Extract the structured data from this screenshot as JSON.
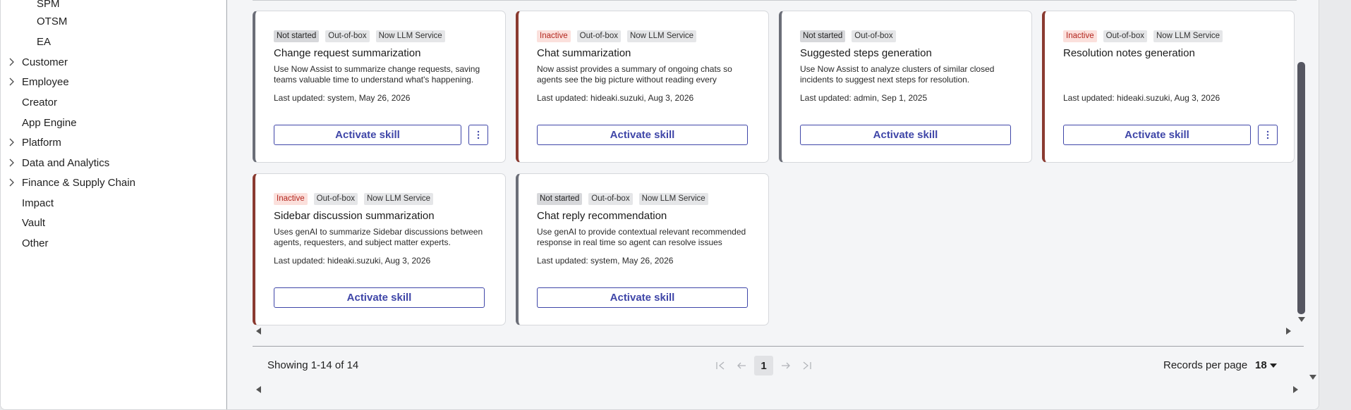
{
  "sidebar": {
    "sub_items": [
      "SPM",
      "OTSM",
      "EA"
    ],
    "items": [
      {
        "label": "Customer",
        "expandable": true
      },
      {
        "label": "Employee",
        "expandable": true
      },
      {
        "label": "Creator",
        "expandable": false
      },
      {
        "label": "App Engine",
        "expandable": false
      },
      {
        "label": "Platform",
        "expandable": true
      },
      {
        "label": "Data and Analytics",
        "expandable": true
      },
      {
        "label": "Finance & Supply Chain",
        "expandable": true
      },
      {
        "label": "Impact",
        "expandable": false
      },
      {
        "label": "Vault",
        "expandable": false
      },
      {
        "label": "Other",
        "expandable": false
      }
    ]
  },
  "cards": [
    {
      "status": "Not started",
      "type": "Out-of-box",
      "service": "Now LLM Service",
      "title": "Change request summarization",
      "description": "Use Now Assist to summarize change requests, saving teams valuable time to understand what's happening.",
      "updated": "Last updated: system, May 26, 2026",
      "button": "Activate skill",
      "has_more": true
    },
    {
      "status": "Inactive",
      "type": "Out-of-box",
      "service": "Now LLM Service",
      "title": "Chat summarization",
      "description": "Now assist provides a summary of ongoing chats so agents see the big picture without reading every messag...",
      "updated": "Last updated: hideaki.suzuki, Aug 3, 2026",
      "button": "Activate skill",
      "has_more": false
    },
    {
      "status": "Not started",
      "type": "Out-of-box",
      "service": "",
      "title": "Suggested steps generation",
      "description": "Use Now Assist to analyze clusters of similar closed incidents to suggest next steps for resolution.",
      "updated": "Last updated: admin, Sep 1, 2025",
      "button": "Activate skill",
      "has_more": false
    },
    {
      "status": "Inactive",
      "type": "Out-of-box",
      "service": "Now LLM Service",
      "title": "Resolution notes generation",
      "description": "",
      "updated": "Last updated: hideaki.suzuki, Aug 3, 2026",
      "button": "Activate skill",
      "has_more": true
    },
    {
      "status": "Inactive",
      "type": "Out-of-box",
      "service": "Now LLM Service",
      "title": "Sidebar discussion summarization",
      "description": "Uses genAI to summarize Sidebar discussions between agents, requesters, and subject matter experts.",
      "updated": "Last updated: hideaki.suzuki, Aug 3, 2026",
      "button": "Activate skill",
      "has_more": false
    },
    {
      "status": "Not started",
      "type": "Out-of-box",
      "service": "Now LLM Service",
      "title": "Chat reply recommendation",
      "description": "Use genAI to provide contextual relevant recommended response in real time so agent can resolve issues more...",
      "updated": "Last updated: system, May 26, 2026",
      "button": "Activate skill",
      "has_more": false
    }
  ],
  "footer": {
    "showing": "Showing 1-14 of 14",
    "current_page": "1",
    "records_label": "Records per page",
    "records_value": "18"
  },
  "colors": {
    "accent": "#3f46a8",
    "inactive_tag_text": "#b3261e",
    "inactive_tag_bg": "#fbe0dc",
    "inactive_border": "#8a3a30",
    "default_border": "#6b6e78"
  }
}
